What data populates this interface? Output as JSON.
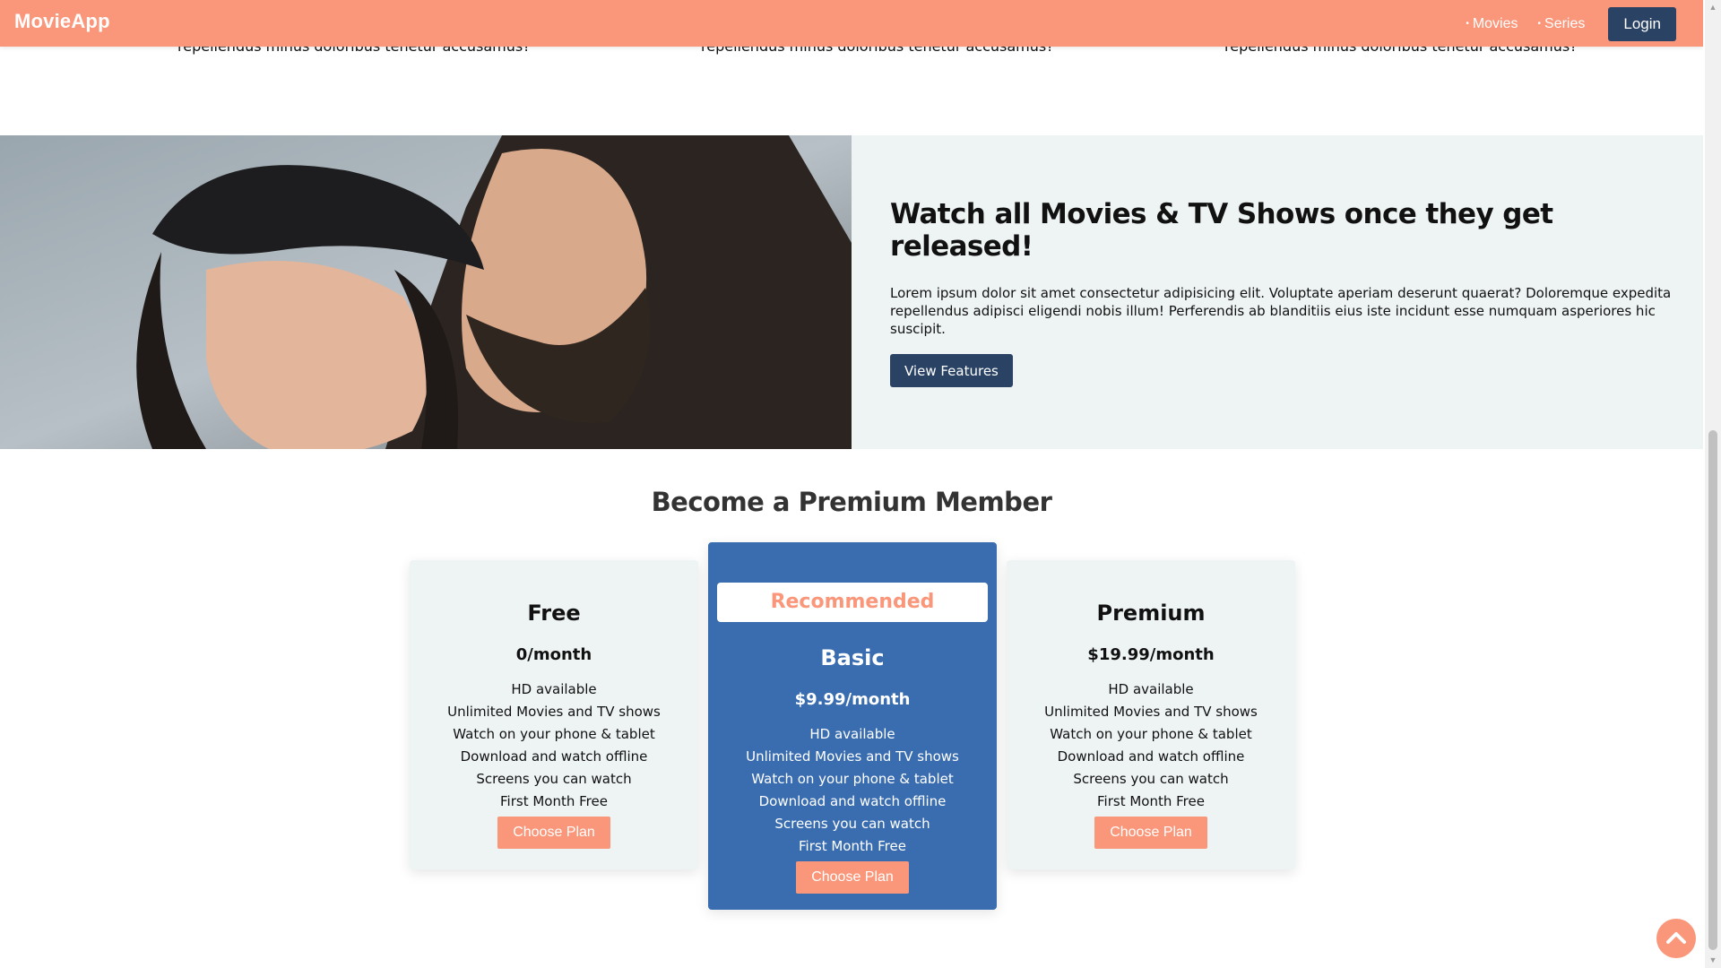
{
  "nav": {
    "brand": "MovieApp",
    "links": [
      "Movies",
      "Series"
    ],
    "login_label": "Login"
  },
  "features_tail": {
    "text": "repellendus minus doloribus tenetur accusamus?"
  },
  "hero": {
    "title": "Watch all Movies & TV Shows once they get released!",
    "description": "Lorem ipsum dolor sit amet consectetur adipisicing elit. Voluptate aperiam deserunt quaerat? Doloremque expedita repellendus adipisci eligendi nobis illum! Perferendis ab blanditiis eius iste incidunt esse numquam asperiores hic suscipit.",
    "button_label": "View Features"
  },
  "pricing": {
    "title": "Become a Premium Member",
    "recommended_label": "Recommended",
    "plans": [
      {
        "name": "Free",
        "price": "0/month",
        "features": [
          "HD available",
          "Unlimited Movies and TV shows",
          "Watch on your phone & tablet",
          "Download and watch offline",
          "Screens you can watch",
          "First Month Free"
        ],
        "button_label": "Choose Plan"
      },
      {
        "name": "Basic",
        "price": "$9.99/month",
        "features": [
          "HD available",
          "Unlimited Movies and TV shows",
          "Watch on your phone & tablet",
          "Download and watch offline",
          "Screens you can watch",
          "First Month Free"
        ],
        "button_label": "Choose Plan"
      },
      {
        "name": "Premium",
        "price": "$19.99/month",
        "features": [
          "HD available",
          "Unlimited Movies and TV shows",
          "Watch on your phone & tablet",
          "Download and watch offline",
          "Screens you can watch",
          "First Month Free"
        ],
        "button_label": "Choose Plan"
      }
    ]
  },
  "colors": {
    "accent": "#fa9679",
    "navy": "#2a4365",
    "highlight_card": "#3a6db0",
    "light_panel": "#eef3f4"
  },
  "icons": {
    "scroll_top": "chevron-up-icon"
  }
}
